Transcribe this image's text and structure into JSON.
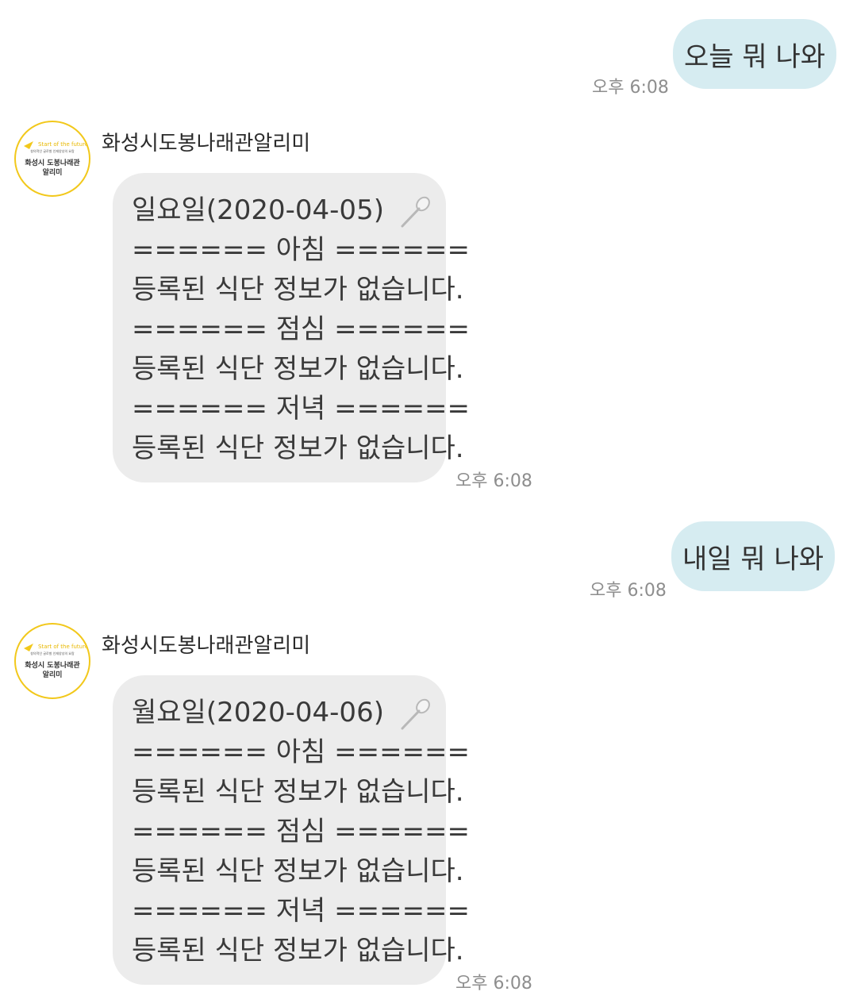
{
  "sender_name": "화성시도봉나래관알리미",
  "avatar": {
    "tag": "Start of the future",
    "tiny": "창의적인 글로벌 인재양성의 요람",
    "line1": "화성시 도봉나래관",
    "line2": "알리미",
    "ring_color": "#f2c81b"
  },
  "colors": {
    "outgoing_bubble": "#d6ecf1",
    "incoming_bubble": "#ececec"
  },
  "messages": [
    {
      "kind": "outgoing",
      "text": "오늘 뭐 나와",
      "time": "오후 6:08"
    },
    {
      "kind": "incoming",
      "lines": [
        "일요일(2020-04-05)",
        "====== 아침 ======",
        "등록된 식단 정보가 없습니다.",
        "====== 점심 ======",
        "등록된 식단 정보가 없습니다.",
        "====== 저녁 ======",
        "등록된 식단 정보가 없습니다."
      ],
      "icon": "spoon-icon",
      "time": "오후 6:08"
    },
    {
      "kind": "outgoing",
      "text": "내일 뭐 나와",
      "time": "오후 6:08"
    },
    {
      "kind": "incoming",
      "lines": [
        "월요일(2020-04-06)",
        "====== 아침 ======",
        "등록된 식단 정보가 없습니다.",
        "====== 점심 ======",
        "등록된 식단 정보가 없습니다.",
        "====== 저녁 ======",
        "등록된 식단 정보가 없습니다."
      ],
      "icon": "spoon-icon",
      "time": "오후 6:08"
    }
  ]
}
